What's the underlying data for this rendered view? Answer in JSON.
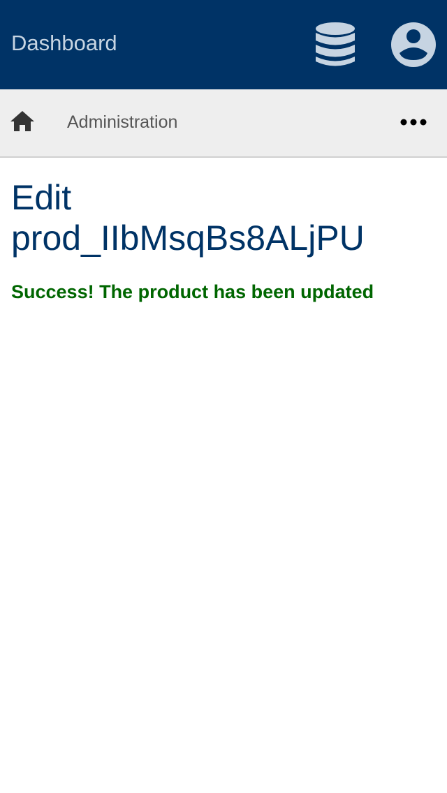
{
  "header": {
    "title": "Dashboard",
    "icons": [
      "database-icon",
      "account-circle-icon"
    ],
    "colors": {
      "background": "#003366",
      "foreground": "#c6d4e2"
    }
  },
  "breadcrumb": {
    "home_icon": "home-icon",
    "items": [
      {
        "label": "Administration"
      }
    ],
    "more_icon": "more-horizontal-icon"
  },
  "main": {
    "title_line1": "Edit",
    "title_line2": "prod_IIbMsqBs8ALjPU",
    "success_message": "Success! The product has been updated"
  },
  "colors": {
    "title": "#003366",
    "success": "#006600",
    "breadcrumb_bg": "#eeeeee"
  }
}
